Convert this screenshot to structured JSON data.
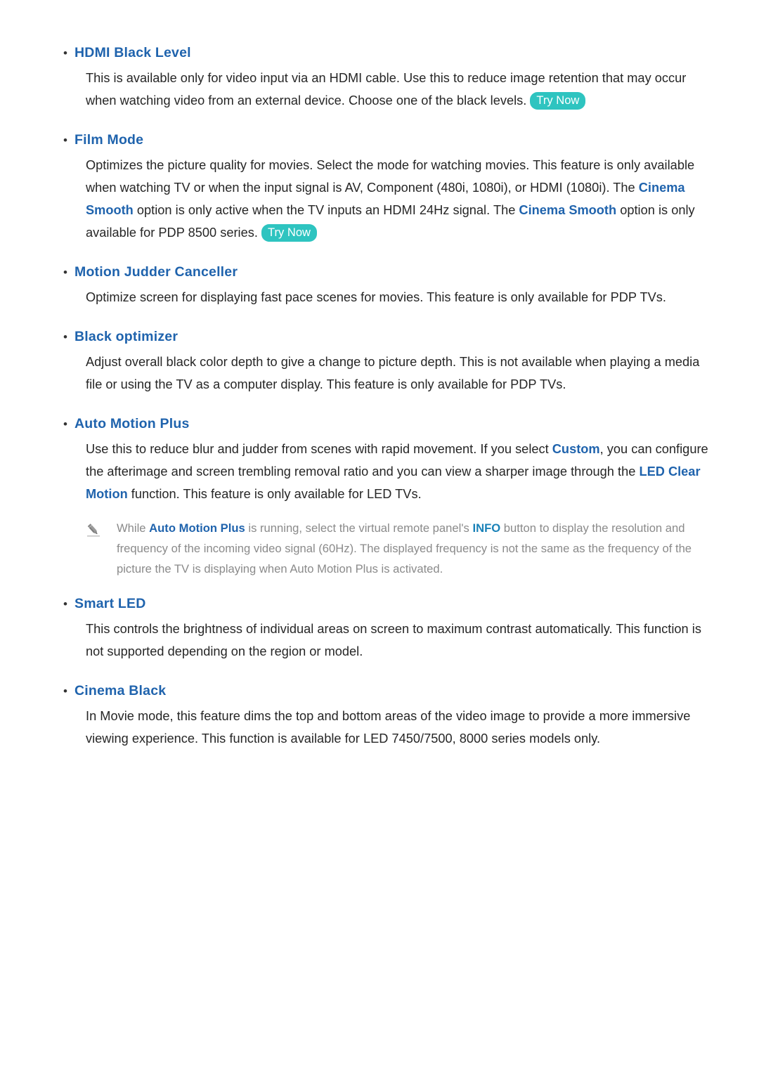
{
  "document": {
    "type": "e-manual-page",
    "colors": {
      "heading_blue": "#1f63ad",
      "body_text": "#262626",
      "note_text": "#8a8a8a",
      "try_now_badge": "#2ec4c0",
      "info_link": "#1a82b8",
      "page_background": "#ffffff"
    },
    "bullet_glyph": "•",
    "try_now_label": "Try Now",
    "note_icon": "pencil-icon"
  },
  "sections": [
    {
      "id": "hdmi-black-level",
      "heading": "HDMI Black Level",
      "body_part_1": "This is available only for video input via an HDMI cable. Use this to reduce image retention that may occur when watching video from an external device. Choose one of the black levels.",
      "has_try_now": true
    },
    {
      "id": "film-mode",
      "heading": "Film Mode",
      "body_part_1": "Optimizes the picture quality for movies. Select the mode for watching movies. This feature is only available when watching TV or when the input signal is AV, Component (480i, 1080i), or HDMI (1080i). The ",
      "highlight_1": "Cinema Smooth",
      "body_part_2": " option is only active when the TV inputs an HDMI 24Hz signal. The ",
      "highlight_2": "Cinema Smooth",
      "body_part_3": " option is only available for PDP 8500 series.",
      "has_try_now": true
    },
    {
      "id": "motion-judder-canceller",
      "heading": "Motion Judder Canceller",
      "body_part_1": "Optimize screen for displaying fast pace scenes for movies. This feature is only available for PDP TVs.",
      "has_try_now": false
    },
    {
      "id": "black-optimizer",
      "heading": "Black optimizer",
      "body_part_1": "Adjust overall black color depth to give a change to picture depth. This is not available when playing a media file or using the TV as a computer display. This feature is only available for PDP TVs.",
      "has_try_now": false
    },
    {
      "id": "auto-motion-plus",
      "heading": "Auto Motion Plus",
      "body_part_1": "Use this to reduce blur and judder from scenes with rapid movement. If you select ",
      "highlight_1": "Custom",
      "body_part_2": ", you can configure the afterimage and screen trembling removal ratio and you can view a sharper image through the ",
      "highlight_2": "LED Clear Motion",
      "body_part_3": " function. This feature is only available for LED TVs.",
      "has_try_now": false,
      "note": {
        "part_1": "While ",
        "term_1": "Auto Motion Plus",
        "part_2": " is running, select the virtual remote panel's ",
        "term_2": "INFO",
        "part_3": " button to display the resolution and frequency of the incoming video signal (60Hz). The displayed frequency is not the same as the frequency of the picture the TV is displaying when Auto Motion Plus is activated."
      }
    },
    {
      "id": "smart-led",
      "heading": "Smart LED",
      "body_part_1": "This controls the brightness of individual areas on screen to maximum contrast automatically. This function is not supported depending on the region or model.",
      "has_try_now": false
    },
    {
      "id": "cinema-black",
      "heading": "Cinema Black",
      "body_part_1": "In Movie mode, this feature dims the top and bottom areas of the video image to provide a more immersive viewing experience. This function is available for LED 7450/7500, 8000 series models only.",
      "has_try_now": false
    }
  ]
}
